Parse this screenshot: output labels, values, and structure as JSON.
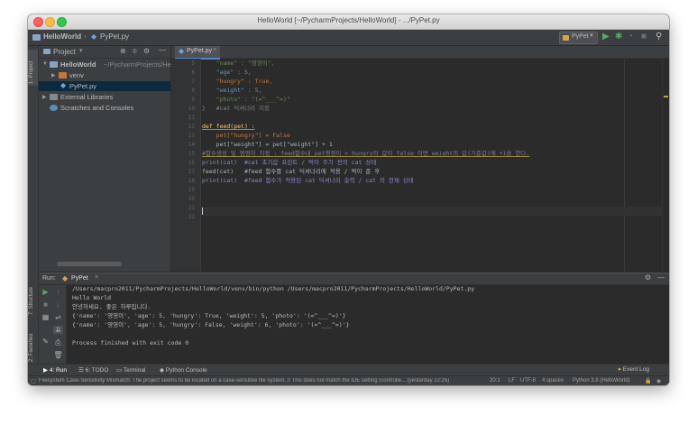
{
  "window_title": "HelloWorld [~/PycharmProjects/HelloWorld] - .../PyPet.py",
  "navbar": {
    "project": "HelloWorld",
    "file": "PyPet.py",
    "run_config": "PyPet"
  },
  "left_strip": {
    "project_tab": "1: Project",
    "structure_tab": "7: Structure",
    "favorites_tab": "2: Favorites"
  },
  "project_panel": {
    "title": "Project",
    "tree": [
      {
        "label": "HelloWorld",
        "path": "~/PycharmProjects/HelloWorld"
      },
      {
        "label": "venv"
      },
      {
        "label": "PyPet.py"
      },
      {
        "label": "External Libraries"
      },
      {
        "label": "Scratches and Consoles"
      }
    ]
  },
  "editor": {
    "tab": "PyPet.py",
    "lines": [
      {
        "n": "5",
        "t": "    \"name\" : \"영영이\","
      },
      {
        "n": "6",
        "t": "    \"age\" : 5,"
      },
      {
        "n": "7",
        "t": "    \"hungry\" : True,"
      },
      {
        "n": "8",
        "t": "    \"weight\" : 5,"
      },
      {
        "n": "9",
        "t": "    \"photo\" : \"(=^___^=)\""
      },
      {
        "n": "10",
        "t": "}   #cat 딕셔너리 지정"
      },
      {
        "n": "11",
        "t": ""
      },
      {
        "n": "12",
        "t": "def feed(pet) :"
      },
      {
        "n": "13",
        "t": "    pet[\"hungry\"] = False"
      },
      {
        "n": "14",
        "t": "    pet[\"weight\"] = pet[\"weight\"] + 1"
      },
      {
        "n": "15",
        "t": "#함수생성 및 영영이 지정 : feed함수내 pet영영이 > hungry의 값이 false 이면 weight의 값(기준값)에 +1을 한다."
      },
      {
        "n": "16",
        "t": "print(cat)  #cat 초기값 프린트 / 먹이 주기 전의 cat 상태"
      },
      {
        "n": "17",
        "t": "feed(cat)   #feed 함수를 cat 딕셔너리에 적용 / 먹이 준 후"
      },
      {
        "n": "18",
        "t": "print(cat)  #feed 함수가 적용된 cat 딕셔너리 출력 / cat 의 현재 상태"
      },
      {
        "n": "19",
        "t": ""
      },
      {
        "n": "20",
        "t": ""
      },
      {
        "n": "21",
        "t": ""
      },
      {
        "n": "22",
        "t": ""
      }
    ]
  },
  "run_panel": {
    "label": "Run:",
    "config": "PyPet",
    "output": [
      "/Users/macpro2011/PycharmProjects/HelloWorld/venv/bin/python /Users/macpro2011/PycharmProjects/HelloWorld/PyPet.py",
      "Hello World",
      "안녕하세요. 좋은 하루입니다.",
      "{'name': '영영이', 'age': 5, 'hungry': True, 'weight': 5, 'photo': '(=^___^=)'}",
      "{'name': '영영이', 'age': 5, 'hungry': False, 'weight': 6, 'photo': '(=^___^=)'}",
      "",
      "Process finished with exit code 0"
    ]
  },
  "bottom_tabs": {
    "run": "4: Run",
    "todo": "6: TODO",
    "terminal": "Terminal",
    "python_console": "Python Console",
    "event_log": "Event Log"
  },
  "status_bar": {
    "message": "Filesystem Case-Sensitivity Mismatch: The project seems to be located on a case-sensitive file system. // This does not match the IDE setting (controlle... (yesterday 22:25)",
    "position": "20:1",
    "line_sep": "LF",
    "encoding": "UTF-8",
    "indent": "4 spaces",
    "interpreter": "Python 3.8 (HelloWorld)"
  },
  "colors": {
    "accent": "#4a88c7",
    "bg": "#2b2b2b",
    "panel": "#3c3f41"
  }
}
